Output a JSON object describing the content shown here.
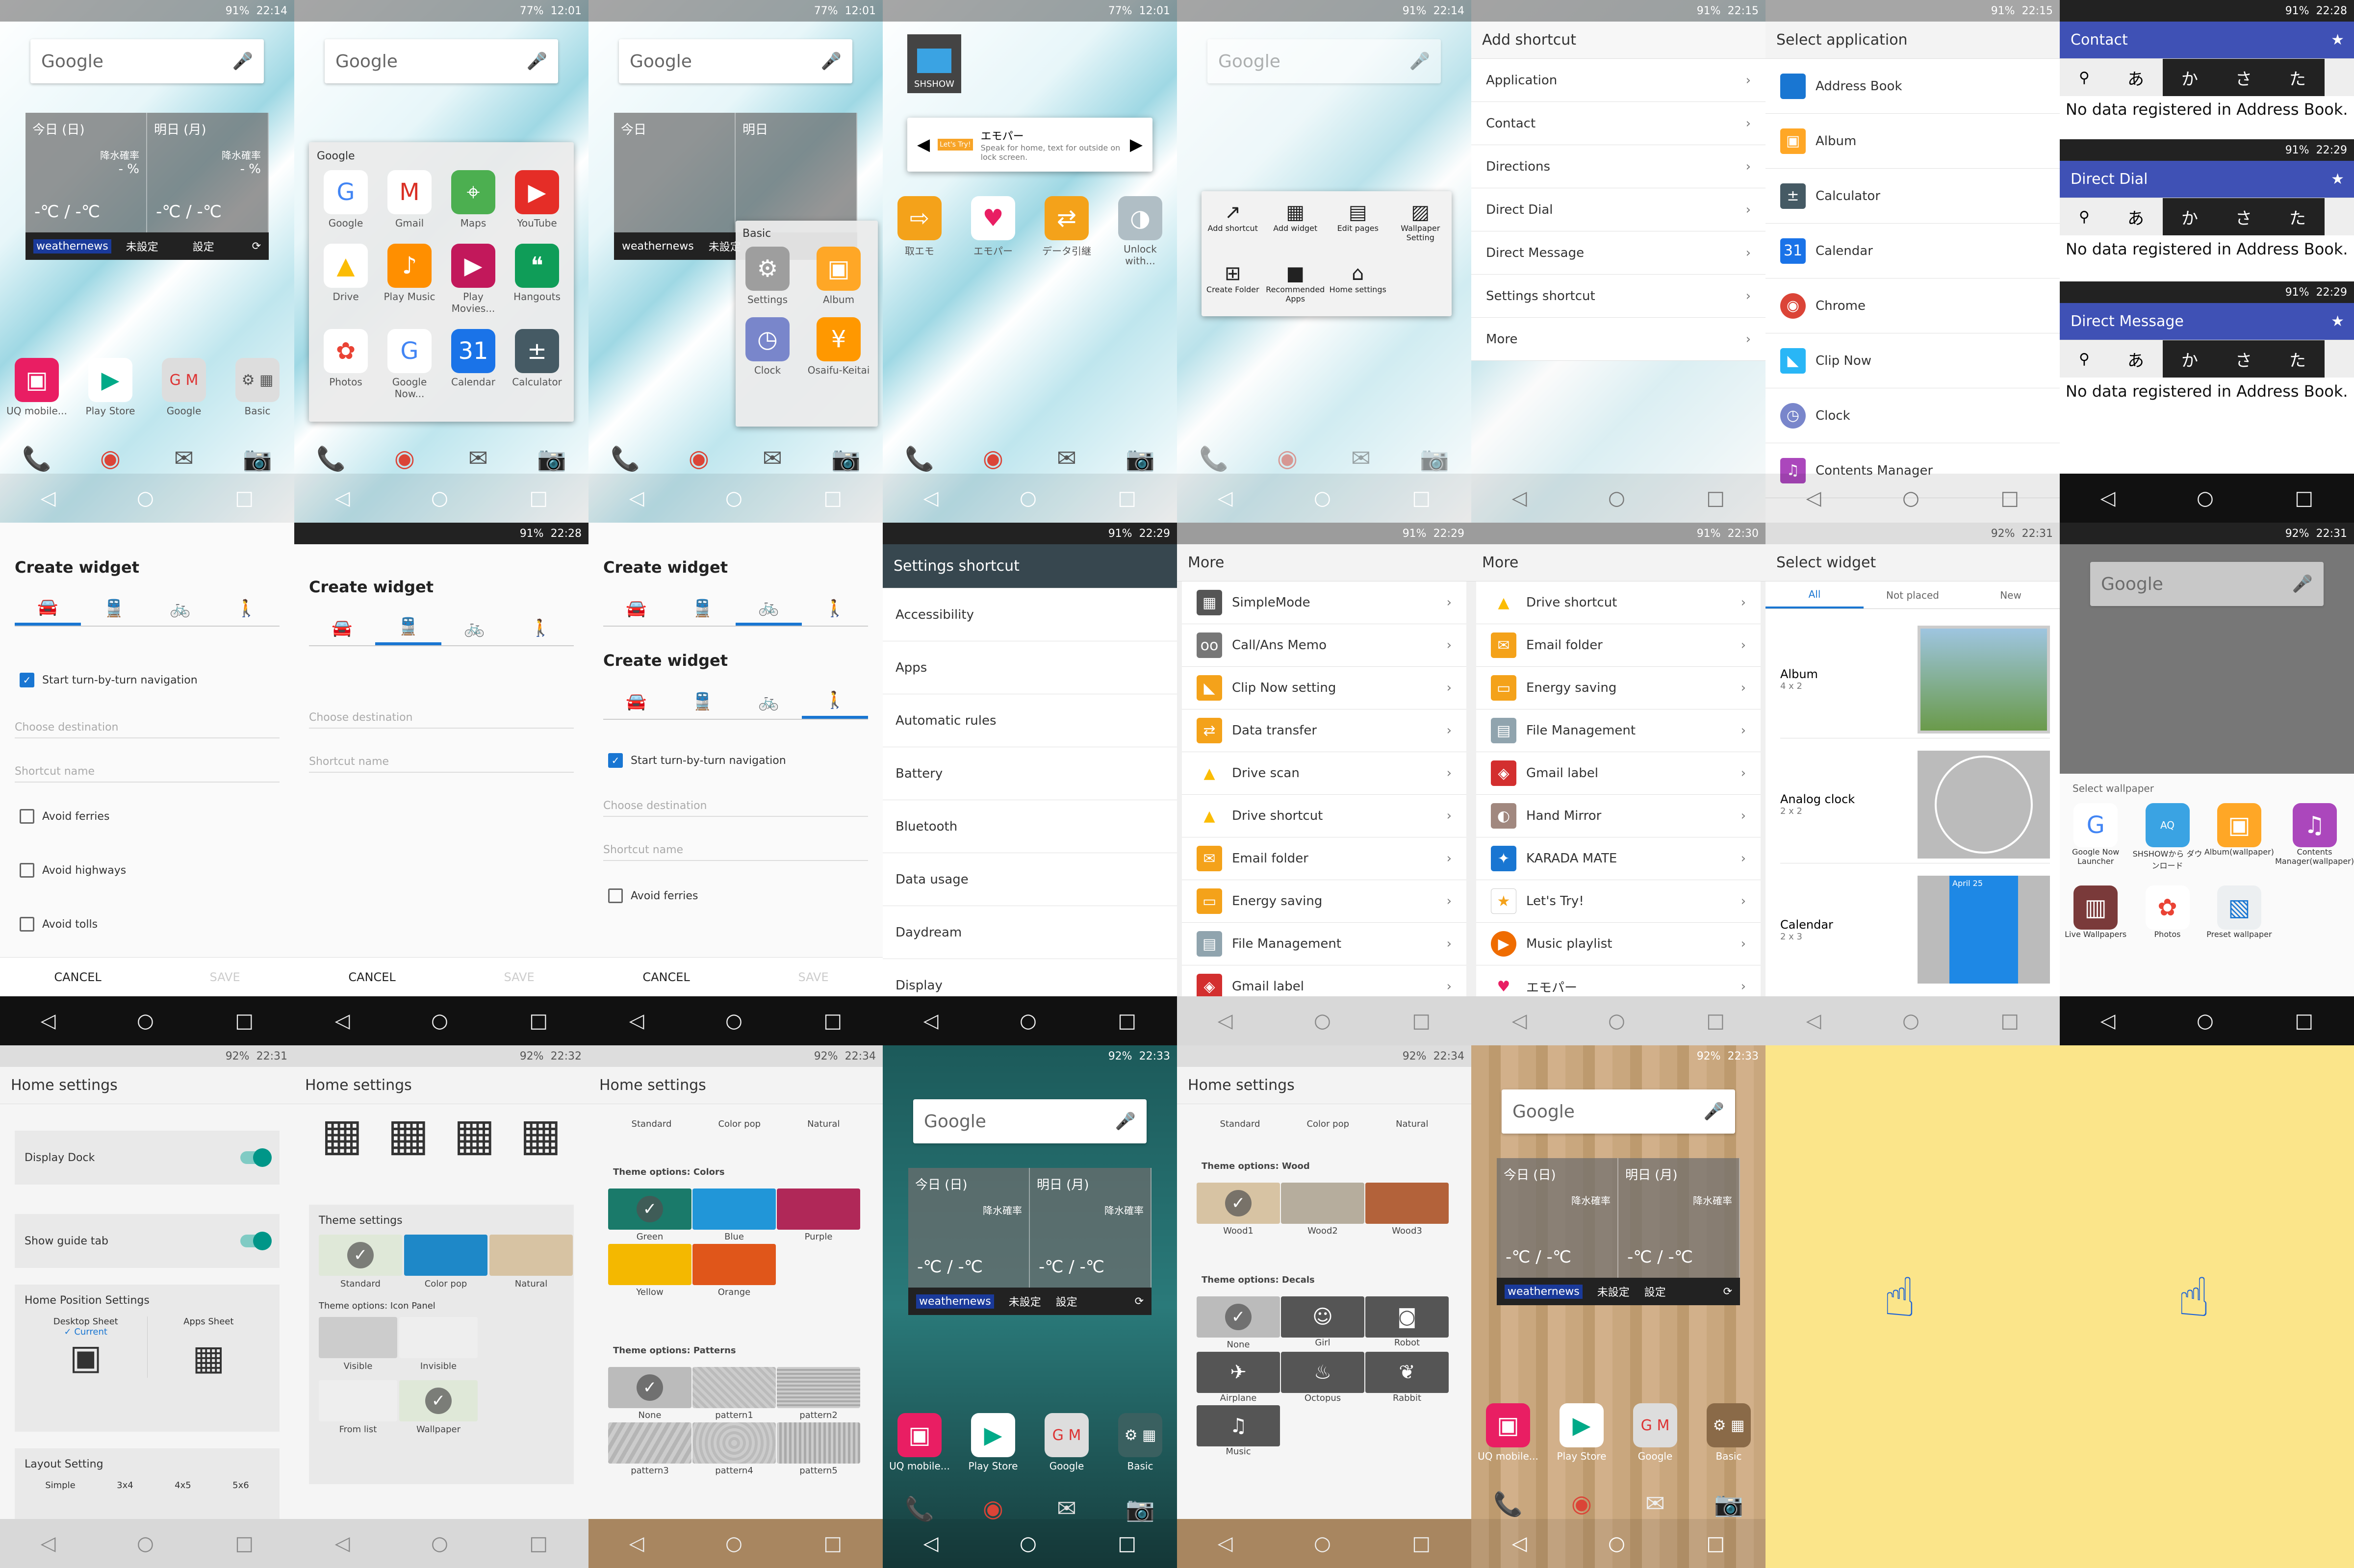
{
  "status": {
    "t1": "22:14",
    "t2": "12:01",
    "t3": "12:01",
    "t4": "12:01",
    "t5": "22:14",
    "t6": "22:15",
    "t7": "22:15",
    "t8": "22:28",
    "t9": "22:28",
    "t10": "22:29",
    "t11": "22:29",
    "t12": "22:30",
    "t13": "22:31",
    "t14": "22:31",
    "t15": "22:31",
    "t16": "22:32",
    "t17": "22:34",
    "t18": "22:33",
    "t19": "22:34",
    "t20": "22:33",
    "bat91": "91%",
    "bat77": "77%",
    "bat92": "92%",
    "t21": "22:29",
    "t22": "22:29"
  },
  "google": "Google",
  "weather": {
    "today": "今日",
    "today_sub": "(日)",
    "tomorrow": "明日",
    "tomorrow_sub": "(月)",
    "rain": "降水確率",
    "pct": "- %",
    "temp": "-℃ / -℃",
    "dash": "-",
    "brand": "weathernews",
    "unset": "未設定",
    "settings": "設定"
  },
  "home_apps": {
    "uq": "UQ mobile...",
    "play": "Play Store",
    "google": "Google",
    "basic": "Basic"
  },
  "google_folder": {
    "title": "Google",
    "apps": [
      "Google",
      "Gmail",
      "Maps",
      "YouTube",
      "Drive",
      "Play Music",
      "Play Movies...",
      "Hangouts",
      "Photos",
      "Google Now...",
      "Calendar",
      "Calculator"
    ]
  },
  "basic_folder": {
    "title": "Basic",
    "apps": [
      "Settings",
      "Album",
      "Clock",
      "Osaifu-Keitai"
    ]
  },
  "shshow": {
    "badge": "SHSHOW",
    "title": "エモパー",
    "text": "Speak for home, text for outside on lock screen.",
    "lets": "Let's Try!",
    "apps": [
      "取エモ",
      "エモパー",
      "データ引継",
      "Unlock with..."
    ]
  },
  "longpress_menu": [
    "Add shortcut",
    "Add widget",
    "Edit pages",
    "Wallpaper Setting",
    "Create Folder",
    "Recommended Apps",
    "Home settings"
  ],
  "add_shortcut": {
    "title": "Add shortcut",
    "items": [
      "Application",
      "Contact",
      "Directions",
      "Direct Dial",
      "Direct Message",
      "Settings shortcut",
      "More"
    ]
  },
  "select_app": {
    "title": "Select application",
    "items": [
      "Address Book",
      "Album",
      "Calculator",
      "Calendar",
      "Chrome",
      "Clip Now",
      "Clock",
      "Contents Manager"
    ]
  },
  "contact_panels": [
    {
      "title": "Contact",
      "msg": "No data registered in Address Book."
    },
    {
      "title": "Direct Dial",
      "msg": "No data registered in Address Book."
    },
    {
      "title": "Direct Message",
      "msg": "No data registered in Address Book."
    }
  ],
  "kana": [
    "あ",
    "か",
    "さ",
    "た"
  ],
  "create_widget": {
    "title": "Create widget",
    "nav": "Start turn-by-turn navigation",
    "dest": "Choose destination",
    "name": "Shortcut name",
    "ferries": "Avoid ferries",
    "highways": "Avoid highways",
    "tolls": "Avoid tolls",
    "cancel": "CANCEL",
    "save": "SAVE"
  },
  "settings_shortcut": {
    "title": "Settings shortcut",
    "items": [
      "Accessibility",
      "Apps",
      "Automatic rules",
      "Battery",
      "Bluetooth",
      "Data usage",
      "Daydream",
      "Display"
    ]
  },
  "more1": {
    "title": "More",
    "items": [
      "SimpleMode",
      "Call/Ans Memo",
      "Clip Now setting",
      "Data transfer",
      "Drive scan",
      "Drive shortcut",
      "Email folder",
      "Energy saving",
      "File Management",
      "Gmail label"
    ]
  },
  "more2": {
    "title": "More",
    "items": [
      "Drive shortcut",
      "Email folder",
      "Energy saving",
      "File Management",
      "Gmail label",
      "Hand Mirror",
      "KARADA MATE",
      "Let's Try!",
      "Music playlist",
      "エモパー"
    ]
  },
  "select_widget": {
    "title": "Select widget",
    "tabs": [
      "All",
      "Not placed",
      "New"
    ],
    "items": [
      {
        "name": "Album",
        "size": "4 x 2"
      },
      {
        "name": "Analog clock",
        "size": "2 x 2"
      },
      {
        "name": "Calendar",
        "size": "2 x 3"
      }
    ],
    "cal_date": "April 25"
  },
  "wallpaper": {
    "title": "Select wallpaper",
    "items": [
      "Google Now Launcher",
      "SHSHOWから ダウンロード",
      "Album(wallpaper)",
      "Contents Manager(wallpaper)",
      "Live Wallpapers",
      "Photos",
      "Preset wallpaper"
    ]
  },
  "home_settings": {
    "title": "Home settings",
    "dock": "Display Dock",
    "guide": "Show guide tab",
    "pos": "Home Position Settings",
    "desktop": "Desktop Sheet",
    "current": "✓ Current",
    "apps": "Apps Sheet",
    "layout": "Layout Setting",
    "layouts": [
      "Simple",
      "3x4",
      "4x5",
      "5x6"
    ],
    "theme": "Theme settings",
    "t_std": "Standard",
    "t_pop": "Color pop",
    "t_nat": "Natural",
    "icon_panel": "Theme options: Icon Panel",
    "visible": "Visible",
    "invisible": "Invisible",
    "from_list": "From list",
    "wallpaper": "Wallpaper"
  },
  "theme_colors": {
    "head": "Theme options: Colors",
    "items": [
      "Green",
      "Blue",
      "Purple",
      "Yellow",
      "Orange"
    ],
    "patterns_head": "Theme options: Patterns",
    "patterns": [
      "None",
      "pattern1",
      "pattern2",
      "pattern3",
      "pattern4",
      "pattern5"
    ]
  },
  "theme_wood": {
    "head": "Theme options: Wood",
    "items": [
      "Wood1",
      "Wood2",
      "Wood3"
    ],
    "decals_head": "Theme options: Decals",
    "decals": [
      "None",
      "Girl",
      "Robot",
      "Airplane",
      "Octopus",
      "Rabbit",
      "Music"
    ]
  },
  "colors": {
    "accent": "#1976d2",
    "teal": "#009688",
    "indigo": "#3f51b5",
    "yellow": "#fbe58a"
  }
}
